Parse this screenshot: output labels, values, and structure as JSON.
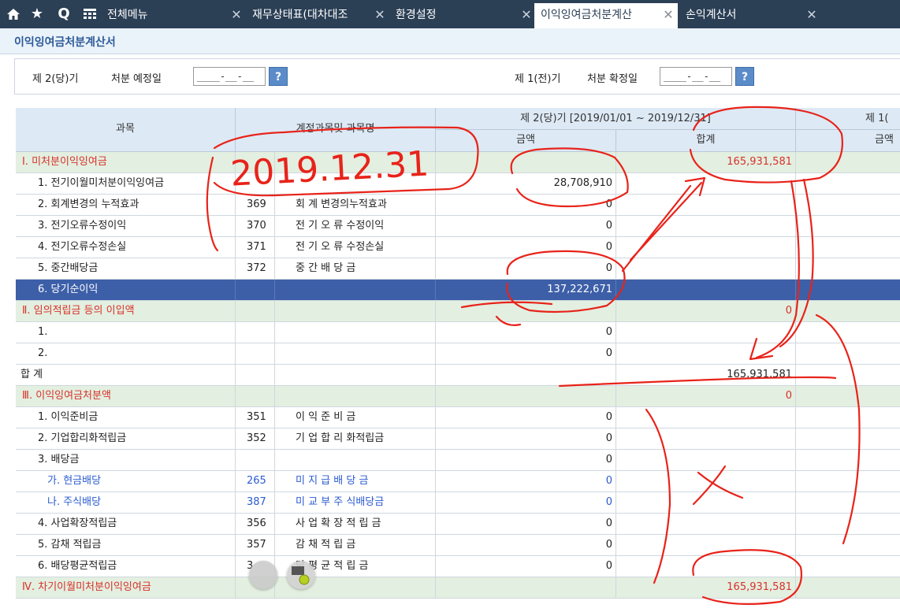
{
  "tabs": {
    "menu_label": "전체메뉴",
    "items": [
      {
        "label": "재무상태표(대차대조"
      },
      {
        "label": "환경설정"
      },
      {
        "label": "이익잉여금처분계산"
      },
      {
        "label": "손익계산서"
      }
    ]
  },
  "page_title": "이익잉여금처분계산서",
  "filter": {
    "current_label": "제 2(당)기",
    "current_date_label": "처분 예정일",
    "current_date_value": "____-__-__",
    "prior_label": "제 1(전)기",
    "prior_date_label": "처분 확정일",
    "prior_date_value": "____-__-__",
    "help_label": "?"
  },
  "header": {
    "col_subject": "과목",
    "col_account": "계정과목및 과목명",
    "period_current": "제 2(당)기 [2019/01/01 ~ 2019/12/31]",
    "period_prior": "제 1(",
    "amount": "금액",
    "total": "합계",
    "amount_prior": "금액"
  },
  "rows": [
    {
      "subject": "Ⅰ. 미처분이익잉여금",
      "code": "",
      "name": "",
      "amount": "",
      "total": "165,931,581"
    },
    {
      "subject": "1. 전기이월미처분이익잉여금",
      "code": "",
      "name": "",
      "amount": "28,708,910",
      "total": ""
    },
    {
      "subject": "2. 회계변경의 누적효과",
      "code": "369",
      "name": "회 계 변경의누적효과",
      "amount": "0",
      "total": ""
    },
    {
      "subject": "3. 전기오류수정이익",
      "code": "370",
      "name": "전 기 오 류 수정이익",
      "amount": "0",
      "total": ""
    },
    {
      "subject": "4. 전기오류수정손실",
      "code": "371",
      "name": "전 기 오 류 수정손실",
      "amount": "0",
      "total": ""
    },
    {
      "subject": "5. 중간배당금",
      "code": "372",
      "name": "중   간   배   당   금",
      "amount": "0",
      "total": ""
    },
    {
      "subject": "6. 당기순이익",
      "code": "",
      "name": "",
      "amount": "137,222,671",
      "total": ""
    },
    {
      "subject": "Ⅱ. 임의적립금 등의 이입액",
      "code": "",
      "name": "",
      "amount": "",
      "total": "0"
    },
    {
      "subject": "1.",
      "code": "",
      "name": "",
      "amount": "0",
      "total": ""
    },
    {
      "subject": "2.",
      "code": "",
      "name": "",
      "amount": "0",
      "total": ""
    },
    {
      "subject": "합 계",
      "code": "",
      "name": "",
      "amount": "",
      "total": "165,931,581"
    },
    {
      "subject": "Ⅲ. 이익잉여금처분액",
      "code": "",
      "name": "",
      "amount": "",
      "total": "0"
    },
    {
      "subject": "1. 이익준비금",
      "code": "351",
      "name": "이    익    준  비  금",
      "amount": "0",
      "total": ""
    },
    {
      "subject": "2. 기업합리화적립금",
      "code": "352",
      "name": "기 업 합 리 화적립금",
      "amount": "0",
      "total": ""
    },
    {
      "subject": "3. 배당금",
      "code": "",
      "name": "",
      "amount": "0",
      "total": ""
    },
    {
      "subject": "가. 현금배당",
      "code": "265",
      "name": "미  지  급  배  당  금",
      "amount": "0",
      "total": ""
    },
    {
      "subject": "나. 주식배당",
      "code": "387",
      "name": "미 교 부 주 식배당금",
      "amount": "0",
      "total": ""
    },
    {
      "subject": "4. 사업확장적립금",
      "code": "356",
      "name": "사 업 확 장 적 립 금",
      "amount": "0",
      "total": ""
    },
    {
      "subject": "5. 감채 적립금",
      "code": "357",
      "name": "감    채    적   립   금",
      "amount": "0",
      "total": ""
    },
    {
      "subject": "6. 배당평균적립금",
      "code": "3",
      "name": "당 평 균 적 립 금",
      "amount": "0",
      "total": ""
    },
    {
      "subject": "Ⅳ. 차기이월미처분이익잉여금",
      "code": "",
      "name": "",
      "amount": "",
      "total": "165,931,581"
    }
  ],
  "annotation": {
    "handwritten_date": "2019.12.31"
  },
  "colors": {
    "topbar": "#2b3f55",
    "selected_row": "#3d5fa8",
    "section_row": "#e3efe0",
    "red_text": "#d8312a",
    "blue_text": "#2a5bd0",
    "ink": "#e8231a"
  }
}
